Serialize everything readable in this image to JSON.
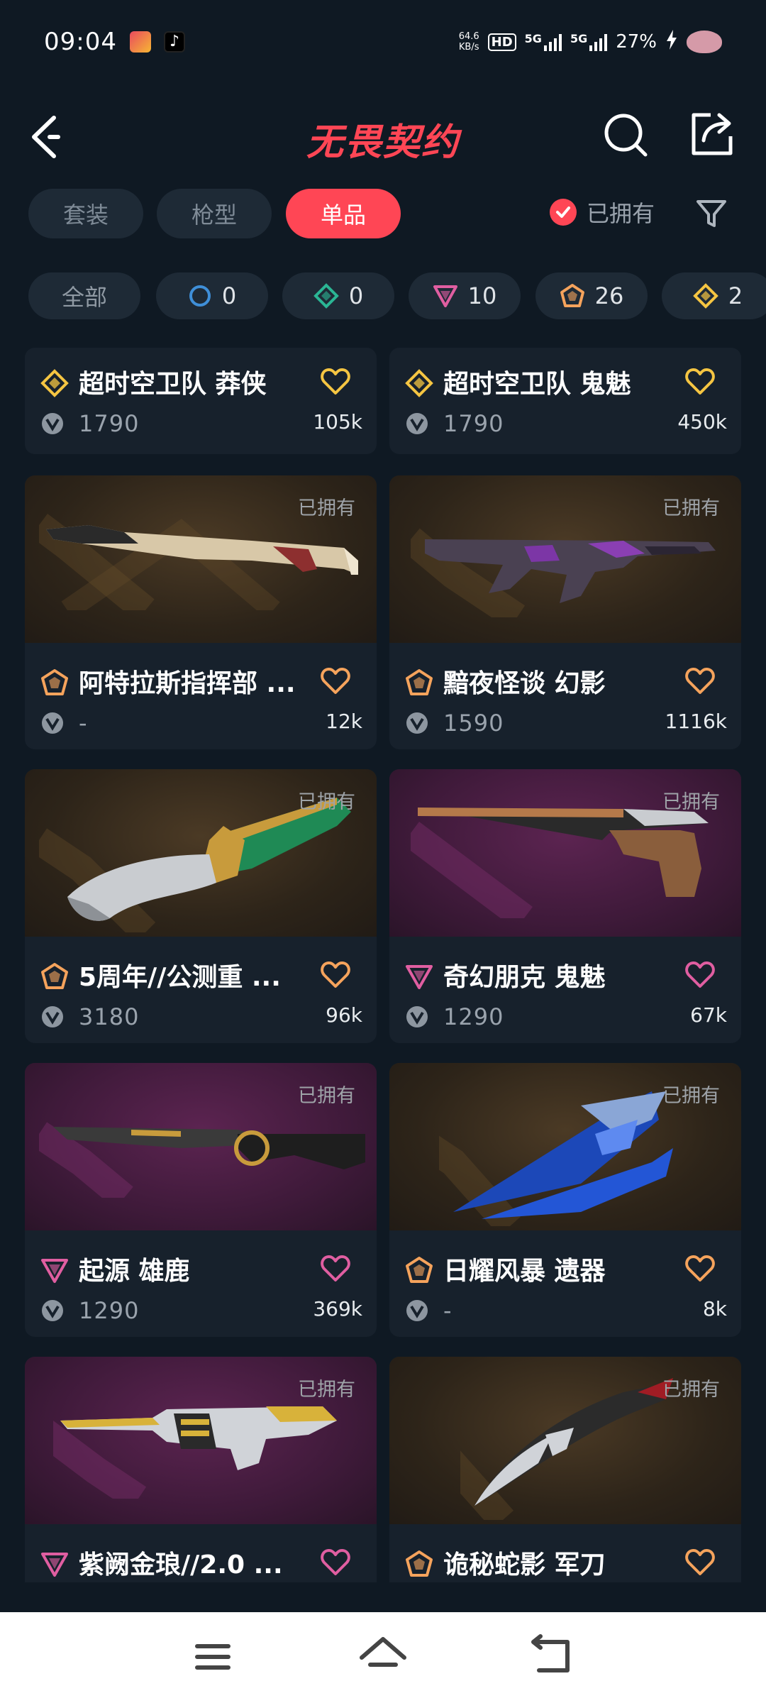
{
  "status_bar": {
    "time": "09:04",
    "net_speed_top": "64.6",
    "net_speed_bottom": "KB/s",
    "hd": "HD",
    "sim1": "5G",
    "sim2": "5G",
    "battery": "27%"
  },
  "header": {
    "title": "无畏契约",
    "brand_color": "#ff4655"
  },
  "tabs": [
    {
      "label": "套装"
    },
    {
      "label": "枪型"
    },
    {
      "label": "单品",
      "active": true
    }
  ],
  "owned_filter": {
    "label": "已拥有",
    "checked": true
  },
  "chips": [
    {
      "label": "全部"
    },
    {
      "tier": "select",
      "count": "0"
    },
    {
      "tier": "deluxe",
      "count": "0"
    },
    {
      "tier": "premium",
      "count": "10"
    },
    {
      "tier": "exclusive",
      "count": "26"
    },
    {
      "tier": "ultra",
      "count": "2"
    }
  ],
  "colors": {
    "accent": "#ff4655",
    "tier_ultra": "#f5c542",
    "tier_exclusive": "#f5a35c",
    "tier_premium": "#e05ea1",
    "tier_deluxe": "#2bb594",
    "tier_select": "#3f8fd8"
  },
  "items": [
    {
      "name": "超时空卫队 莽侠",
      "tier": "ultra",
      "price": "1790",
      "favs": "105k",
      "owned_label": ""
    },
    {
      "name": "超时空卫队 鬼魅",
      "tier": "ultra",
      "price": "1790",
      "favs": "450k",
      "owned_label": ""
    },
    {
      "name": "阿特拉斯指挥部 ...",
      "tier": "exclusive",
      "price": "-",
      "favs": "12k",
      "owned_label": "已拥有"
    },
    {
      "name": "黯夜怪谈 幻影",
      "tier": "exclusive",
      "price": "1590",
      "favs": "1116k",
      "owned_label": "已拥有"
    },
    {
      "name": "5周年//公测重 ...",
      "tier": "exclusive",
      "price": "3180",
      "favs": "96k",
      "owned_label": "已拥有"
    },
    {
      "name": "奇幻朋克 鬼魅",
      "tier": "premium",
      "price": "1290",
      "favs": "67k",
      "owned_label": "已拥有"
    },
    {
      "name": "起源 雄鹿",
      "tier": "premium",
      "price": "1290",
      "favs": "369k",
      "owned_label": "已拥有"
    },
    {
      "name": "日耀风暴 遗器",
      "tier": "exclusive",
      "price": "-",
      "favs": "8k",
      "owned_label": "已拥有"
    },
    {
      "name": "紫阙金琅//2.0 ...",
      "tier": "premium",
      "price": "",
      "favs": "",
      "owned_label": "已拥有"
    },
    {
      "name": "诡秘蛇影 军刀",
      "tier": "exclusive",
      "price": "",
      "favs": "",
      "owned_label": "已拥有"
    }
  ]
}
